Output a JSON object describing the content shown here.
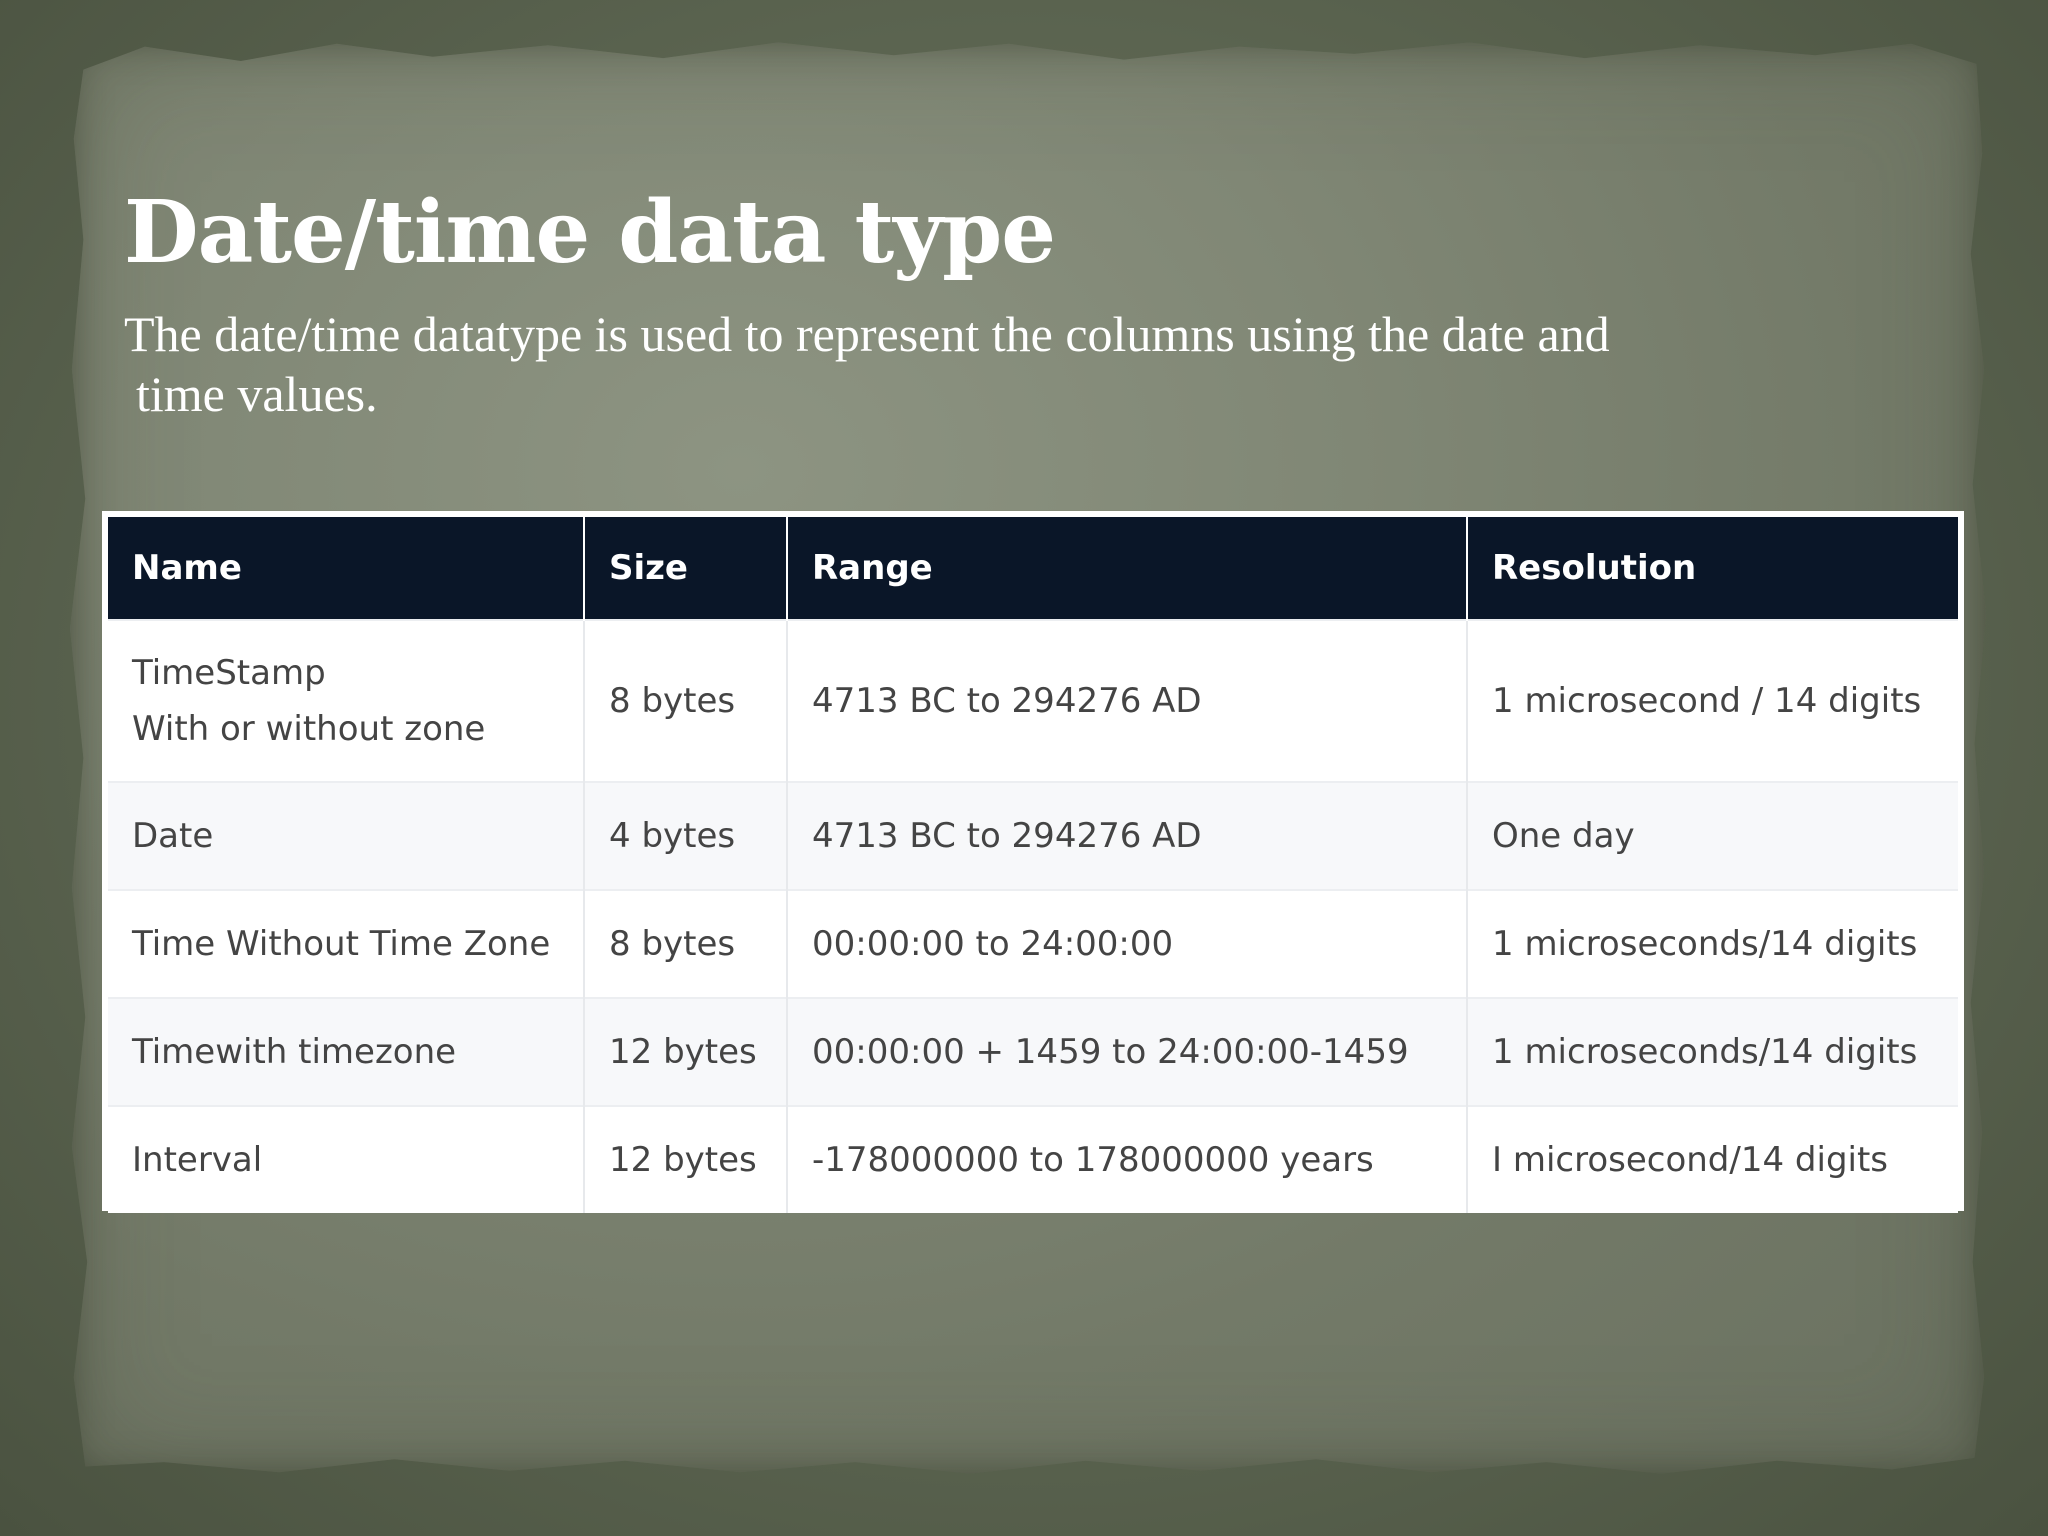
{
  "slide": {
    "title": "Date/time data type",
    "subtitle_line1": "The date/time datatype is used to represent the columns using the date and",
    "subtitle_line2": "time values."
  },
  "table": {
    "headers": [
      "Name",
      "Size",
      "Range",
      "Resolution"
    ],
    "rows": [
      {
        "name_line1": "TimeStamp",
        "name_line2": "With or without zone",
        "size": "8 bytes",
        "range": "4713 BC to 294276 AD",
        "resolution": "1 microsecond / 14 digits"
      },
      {
        "name": "Date",
        "size": "4 bytes",
        "range": "4713 BC to 294276 AD",
        "resolution": "One day"
      },
      {
        "name": "Time Without Time Zone",
        "size": "8 bytes",
        "range": "00:00:00 to 24:00:00",
        "resolution": "1 microseconds/14 digits"
      },
      {
        "name": "Timewith timezone",
        "size": "12 bytes",
        "range": "00:00:00 + 1459 to 24:00:00-1459",
        "resolution": "1 microseconds/14 digits"
      },
      {
        "name": "Interval",
        "size": "12 bytes",
        "range": "-178000000 to 178000000 years",
        "resolution": "I microsecond/14 digits"
      }
    ]
  },
  "colors": {
    "header_background": "#0a1628",
    "paper": "#808775",
    "frame": "#5b6450",
    "text_light": "#ffffff",
    "cell_text": "#444444"
  }
}
